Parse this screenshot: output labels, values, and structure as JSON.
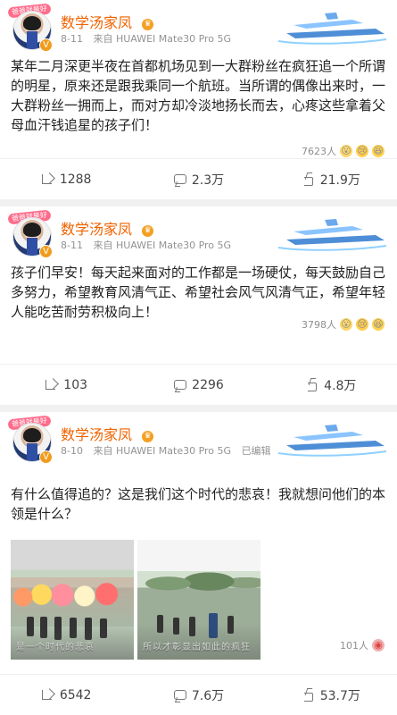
{
  "posts": [
    {
      "avatar_badge": "爸爸就是好",
      "username": "数学汤家凤",
      "date": "8-11",
      "source": "来自 HUAWEI Mate30 Pro 5G",
      "edited": "",
      "content": "某年二月深更半夜在首都机场见到一大群粉丝在疯狂追一个所谓的明星，原来还是跟我乘同一个航班。当所谓的偶像出来时，一大群粉丝一拥而上，而对方却冷淡地扬长而去，心疼这些拿着父母血汗钱追星的孩子们！",
      "reaction_count": "7623人",
      "actions": {
        "repost": "1288",
        "comment": "2.3万",
        "like": "21.9万"
      }
    },
    {
      "avatar_badge": "爸爸就是好",
      "username": "数学汤家凤",
      "date": "8-11",
      "source": "来自 HUAWEI Mate30 Pro 5G",
      "edited": "",
      "content": "孩子们早安！每天起来面对的工作都是一场硬仗，每天鼓励自己多努力，希望教育风清气正、希望社会风气风清气正，希望年轻人能吃苦耐劳积极向上！",
      "reaction_count": "3798人",
      "actions": {
        "repost": "103",
        "comment": "2296",
        "like": "4.8万"
      }
    },
    {
      "avatar_badge": "爸爸就是好",
      "username": "数学汤家凤",
      "date": "8-10",
      "source": "来自 HUAWEI Mate30 Pro 5G",
      "edited": "已编辑",
      "content": "有什么值得追的？这是我们这个时代的悲哀！我就想问他们的本领是什么？",
      "images": [
        {
          "caption": "是一个时代的悲哀"
        },
        {
          "caption": "所以才彰显出如此的疯狂"
        }
      ],
      "reaction_count": "101人",
      "actions": {
        "repost": "6542",
        "comment": "7.6万",
        "like": "53.7万"
      }
    }
  ]
}
